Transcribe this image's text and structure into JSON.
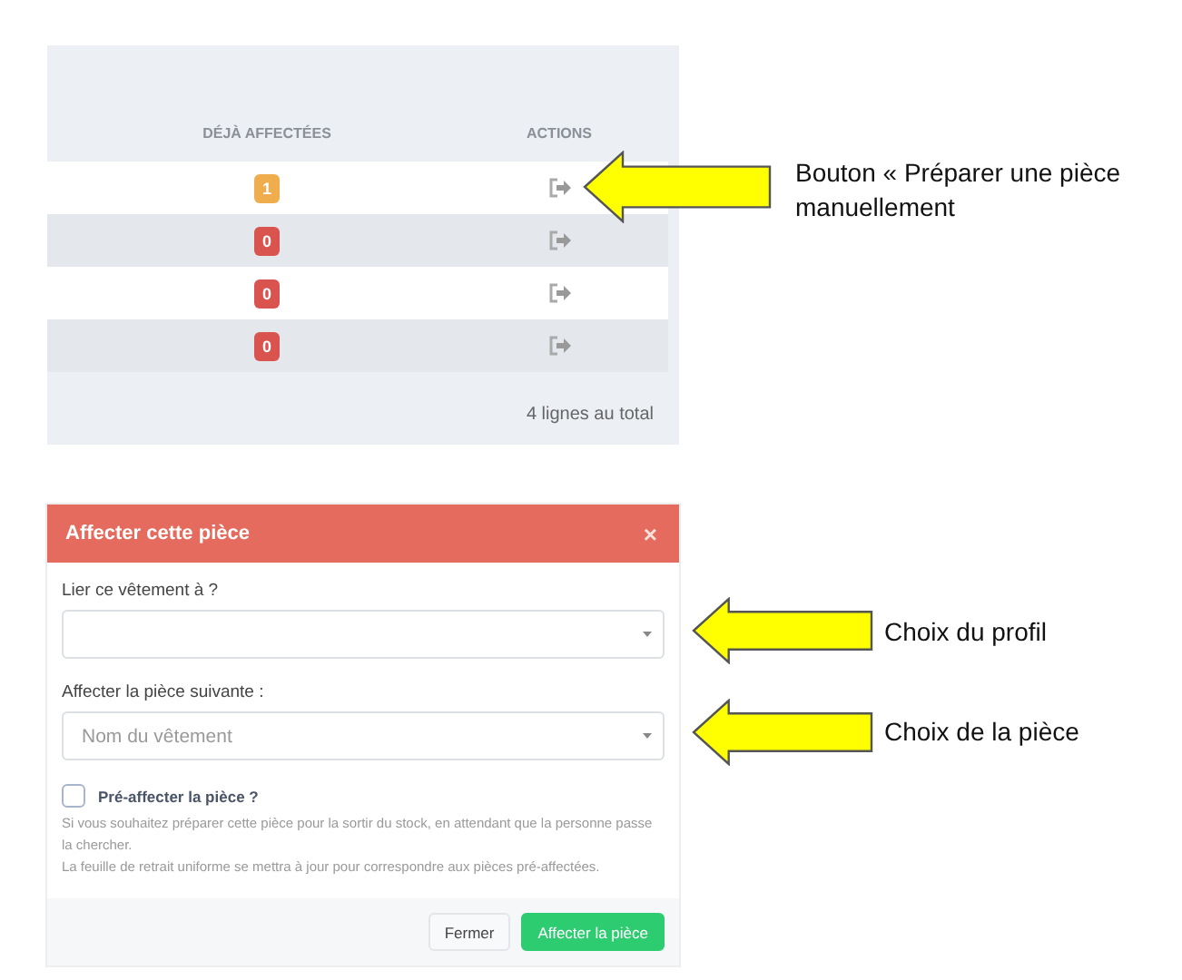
{
  "table": {
    "columns": [
      "DÉJÀ AFFECTÉES",
      "ACTIONS"
    ],
    "rows": [
      {
        "assigned": "1",
        "color": "#f0ad4e"
      },
      {
        "assigned": "0",
        "color": "#d9534f"
      },
      {
        "assigned": "0",
        "color": "#d9534f"
      },
      {
        "assigned": "0",
        "color": "#d9534f"
      }
    ],
    "footer": "4 lignes au total"
  },
  "modal": {
    "title": "Affecter cette pièce",
    "close": "×",
    "fields": [
      {
        "label": "Lier ce vêtement à ?"
      },
      {
        "label": "Affecter la pièce suivante :",
        "placeholder": "Nom du vêtement"
      }
    ],
    "checkbox": {
      "label": "Pré-affecter la pièce ?",
      "checked": false
    },
    "help": [
      "Si vous souhaitez préparer cette pièce pour la sortir du stock, en attendant que la personne passe la chercher.",
      "La feuille de retrait uniforme se mettra à jour pour correspondre aux pièces pré-affectées."
    ],
    "buttons": [
      {
        "label": "Fermer",
        "kind": "secondary"
      },
      {
        "label": "Affecter la pièce",
        "kind": "primary"
      }
    ]
  },
  "annotations": [
    {
      "text": "Bouton « Préparer une pièce manuellement"
    },
    {
      "text": "Choix du profil"
    },
    {
      "text": "Choix de la pièce"
    }
  ]
}
